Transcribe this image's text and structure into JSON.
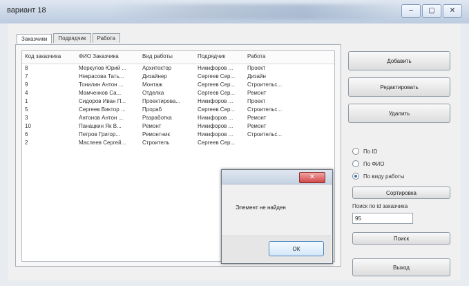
{
  "window": {
    "title": "вариант 18",
    "controls": [
      "–",
      "▢",
      "✕"
    ]
  },
  "tabs": [
    {
      "label": "Заказчики",
      "active": true
    },
    {
      "label": "Подрядчик",
      "active": false
    },
    {
      "label": "Работа",
      "active": false
    }
  ],
  "table": {
    "columns": [
      "Код заказчика",
      "ФИО Заказчика",
      "Вид работы",
      "Подрядчик",
      "Работа"
    ],
    "rows": [
      [
        "8",
        "Меркулов Юрий ...",
        "Архитектор",
        "Никифоров ...",
        "Проект"
      ],
      [
        "7",
        "Некрасова Тать...",
        "Дизайнер",
        "Сергеев Сер...",
        "Дизайн"
      ],
      [
        "9",
        "Тонилин Антон ...",
        "Монтаж",
        "Сергеев Сер...",
        "Строительс..."
      ],
      [
        "4",
        "Мамченков Са...",
        "Отделка",
        "Сергеев Сер...",
        "Ремонт"
      ],
      [
        "1",
        "Сидоров Иван П...",
        "Проектирова...",
        "Никифоров ...",
        "Проект"
      ],
      [
        "5",
        "Сергеев Виктор ...",
        "Прораб",
        "Сергеев Сер...",
        "Строительс..."
      ],
      [
        "3",
        "Антонов Антон ...",
        "Разработка",
        "Никифоров ...",
        "Ремонт"
      ],
      [
        "10",
        "Панацкин Як В...",
        "Ремонт",
        "Никифоров ...",
        "Ремонт"
      ],
      [
        "6",
        "Петров Григор...",
        "Ремонтник",
        "Никифоров ...",
        "Строительс..."
      ],
      [
        "2",
        "Маслеев Сергей...",
        "Строитель",
        "Сергеев Сер...",
        ""
      ]
    ]
  },
  "buttons": {
    "add": "Добавить",
    "edit": "Редактировать",
    "delete": "Удалить",
    "sort": "Сортировка",
    "search": "Поиск",
    "exit": "Выход"
  },
  "radios": [
    {
      "label": "По ID",
      "selected": false
    },
    {
      "label": "По ФИО",
      "selected": false
    },
    {
      "label": "По виду работы",
      "selected": true
    }
  ],
  "search": {
    "label": "Поиск по id заказчика",
    "value": "95"
  },
  "dialog": {
    "message": "Элемент не найден",
    "ok": "ОК",
    "close_icon": "✕"
  }
}
